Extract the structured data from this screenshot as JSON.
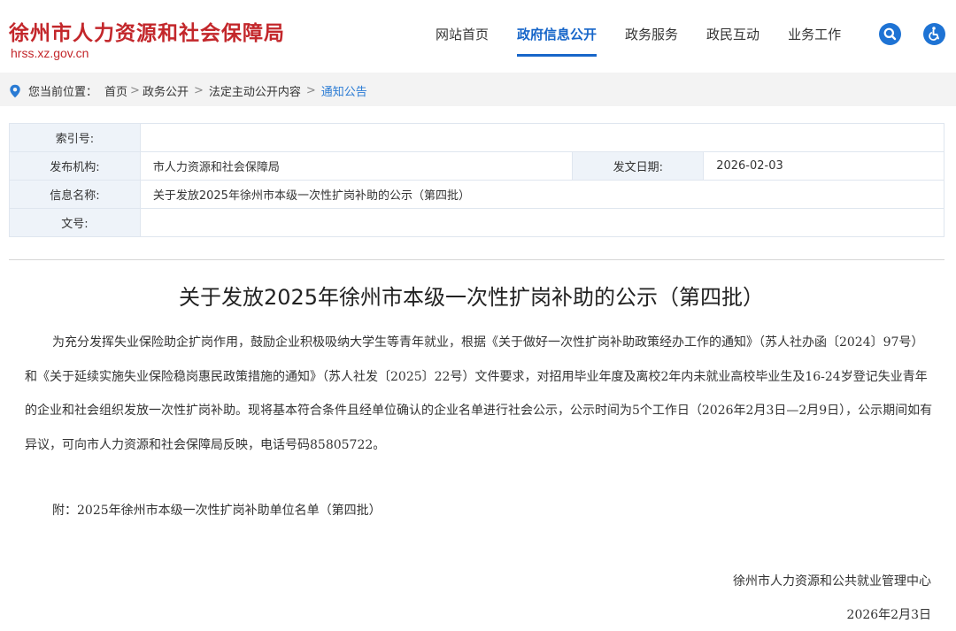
{
  "header": {
    "site_title": "徐州市人力资源和社会保障局",
    "site_url": "hrss.xz.gov.cn",
    "nav": [
      {
        "label": "网站首页",
        "active": false
      },
      {
        "label": "政府信息公开",
        "active": true
      },
      {
        "label": "政务服务",
        "active": false
      },
      {
        "label": "政民互动",
        "active": false
      },
      {
        "label": "业务工作",
        "active": false
      }
    ],
    "search_icon": "search-icon",
    "accessibility_icon": "wheelchair-icon",
    "accent_color": "#1766c9",
    "brand_color": "#c3272b"
  },
  "breadcrumb": {
    "prefix": "您当前位置：",
    "items": [
      "首页",
      "政务公开",
      "法定主动公开内容",
      "通知公告"
    ],
    "separator": ">"
  },
  "meta": {
    "index_label": "索引号:",
    "index_value": "",
    "publisher_label": "发布机构:",
    "publisher_value": "市人力资源和社会保障局",
    "date_label": "发文日期:",
    "date_value": "2026-02-03",
    "name_label": "信息名称:",
    "name_value": "关于发放2025年徐州市本级一次性扩岗补助的公示（第四批）",
    "doc_label": "文号:",
    "doc_value": ""
  },
  "article": {
    "title": "关于发放2025年徐州市本级一次性扩岗补助的公示（第四批）",
    "body": "为充分发挥失业保险助企扩岗作用，鼓励企业积极吸纳大学生等青年就业，根据《关于做好一次性扩岗补助政策经办工作的通知》（苏人社办函〔2024〕97号）和《关于延续实施失业保险稳岗惠民政策措施的通知》（苏人社发〔2025〕22号）文件要求，对招用毕业年度及离校2年内未就业高校毕业生及16-24岁登记失业青年的企业和社会组织发放一次性扩岗补助。现将基本符合条件且经单位确认的企业名单进行社会公示，公示时间为5个工作日（2026年2月3日—2月9日），公示期间如有异议，可向市人力资源和社会保障局反映，电话号码85805722。",
    "attachment": "附：2025年徐州市本级一次性扩岗补助单位名单（第四批）",
    "signature": "徐州市人力资源和公共就业管理中心",
    "date": "2026年2月3日"
  }
}
